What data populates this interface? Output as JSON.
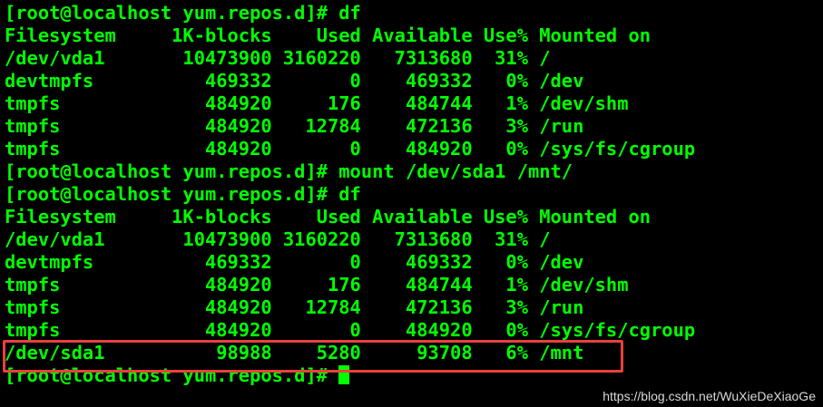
{
  "terminal": {
    "lines": [
      "[root@localhost yum.repos.d]# df",
      "Filesystem     1K-blocks    Used Available Use% Mounted on",
      "/dev/vda1       10473900 3160220   7313680  31% /",
      "devtmpfs          469332       0    469332   0% /dev",
      "tmpfs             484920     176    484744   1% /dev/shm",
      "tmpfs             484920   12784    472136   3% /run",
      "tmpfs             484920       0    484920   0% /sys/fs/cgroup",
      "[root@localhost yum.repos.d]# mount /dev/sda1 /mnt/",
      "[root@localhost yum.repos.d]# df",
      "Filesystem     1K-blocks    Used Available Use% Mounted on",
      "/dev/vda1       10473900 3160220   7313680  31% /",
      "devtmpfs          469332       0    469332   0% /dev",
      "tmpfs             484920     176    484744   1% /dev/shm",
      "tmpfs             484920   12784    472136   3% /run",
      "tmpfs             484920       0    484920   0% /sys/fs/cgroup",
      "/dev/sda1          98988    5280     93708   6% /mnt",
      "[root@localhost yum.repos.d]# "
    ],
    "text_color": "#00ff00",
    "background_color": "#000000"
  },
  "annotation": {
    "highlight_color": "#e8413c"
  },
  "watermark": {
    "text": "https://blog.csdn.net/WuXieDeXiaoGe"
  }
}
